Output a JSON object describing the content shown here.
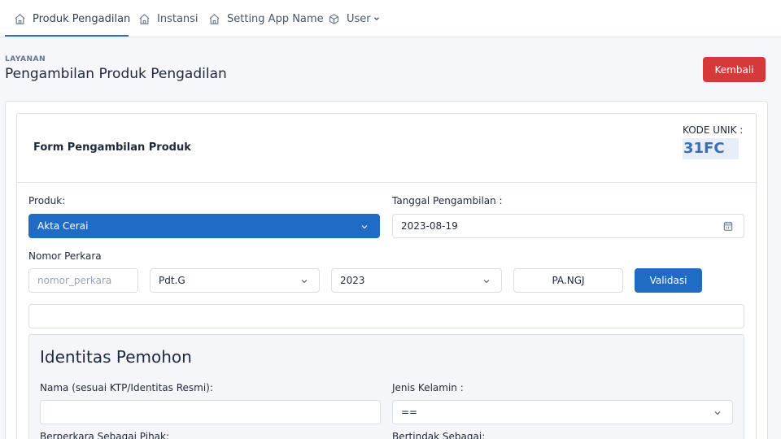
{
  "nav": {
    "items": [
      {
        "label": "Produk Pengadilan",
        "icon": "home-icon",
        "active": true
      },
      {
        "label": "Instansi",
        "icon": "home-icon"
      },
      {
        "label": "Setting App Name",
        "icon": "home-icon"
      },
      {
        "label": "User",
        "icon": "package-icon",
        "dropdown": true
      }
    ]
  },
  "header": {
    "pretitle": "LAYANAN",
    "title": "Pengambilan Produk Pengadilan",
    "back_button": "Kembali"
  },
  "form": {
    "title": "Form Pengambilan Produk",
    "kode_unik_label": "KODE UNIK :",
    "kode_unik_value": "31FC",
    "produk_label": "Produk:",
    "produk_value": "Akta Cerai",
    "tanggal_label": "Tanggal Pengambilan :",
    "tanggal_value": "2023-08-19",
    "nomor_perkara_label": "Nomor Perkara",
    "nomor_perkara_placeholder": "nomor_perkara",
    "jenis_perkara_value": "Pdt.G",
    "tahun_value": "2023",
    "pengadilan_code": "PA.NGJ",
    "validasi_button": "Validasi",
    "validation_result": ""
  },
  "pemohon": {
    "section_title": "Identitas Pemohon",
    "nama_label": "Nama (sesuai KTP/Identitas Resmi):",
    "nama_value": "",
    "jenis_kelamin_label": "Jenis Kelamin :",
    "jenis_kelamin_value": "==",
    "berperkara_label": "Berperkara Sebagai Pihak:",
    "bertindak_label": "Bertindak Sebagai:"
  },
  "colors": {
    "primary": "#206bc4",
    "danger": "#d63939",
    "accent_text": "#3b6fb6"
  }
}
